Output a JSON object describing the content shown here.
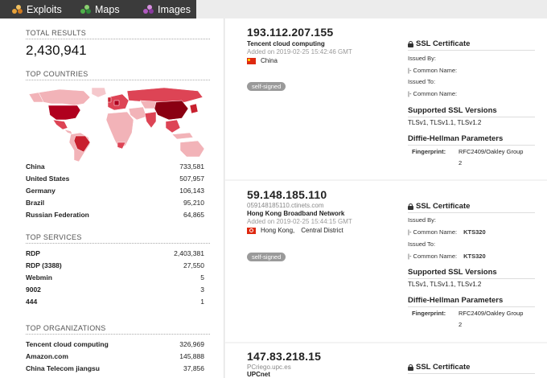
{
  "nav": {
    "items": [
      {
        "label": "Exploits",
        "icon": "exploits-icon"
      },
      {
        "label": "Maps",
        "icon": "maps-icon"
      },
      {
        "label": "Images",
        "icon": "images-icon"
      }
    ]
  },
  "sidebar": {
    "total_results_title": "TOTAL RESULTS",
    "total_results": "2,430,941",
    "top_countries_title": "TOP COUNTRIES",
    "countries": [
      {
        "name": "China",
        "count": "733,581"
      },
      {
        "name": "United States",
        "count": "507,957"
      },
      {
        "name": "Germany",
        "count": "106,143"
      },
      {
        "name": "Brazil",
        "count": "95,210"
      },
      {
        "name": "Russian Federation",
        "count": "64,865"
      }
    ],
    "top_services_title": "TOP SERVICES",
    "services": [
      {
        "name": "RDP",
        "count": "2,403,381"
      },
      {
        "name": "RDP (3388)",
        "count": "27,550"
      },
      {
        "name": "Webmin",
        "count": "5"
      },
      {
        "name": "9002",
        "count": "3"
      },
      {
        "name": "444",
        "count": "1"
      }
    ],
    "top_orgs_title": "TOP ORGANIZATIONS",
    "orgs": [
      {
        "name": "Tencent cloud computing",
        "count": "326,969"
      },
      {
        "name": "Amazon.com",
        "count": "145,888"
      },
      {
        "name": "China Telecom jiangsu",
        "count": "37,856"
      }
    ]
  },
  "results": [
    {
      "ip": "193.112.207.155",
      "org": "Tencent cloud computing",
      "added": "Added on 2019-02-25 15:42:46 GMT",
      "location": "China",
      "tag": "self-signed",
      "ssl_title": "SSL Certificate",
      "issued_by": "Issued By:",
      "common_name_1": "|- Common Name:",
      "issued_to": "Issued To:",
      "common_name_2": "|- Common Name:",
      "versions_title": "Supported SSL Versions",
      "versions": "TLSv1, TLSv1.1, TLSv1.2",
      "dh_title": "Diffie-Hellman Parameters",
      "fingerprint_label": "Fingerprint:",
      "fingerprint_value": "RFC2409/Oakley Group",
      "fingerprint_group": "2"
    },
    {
      "ip": "59.148.185.110",
      "hostname": "059148185110.ctinets.com",
      "org": "Hong Kong Broadband Network",
      "added": "Added on 2019-02-25 15:44:15 GMT",
      "location": "Hong Kong,",
      "city": "Central District",
      "tag": "self-signed",
      "ssl_title": "SSL Certificate",
      "issued_by": "Issued By:",
      "common_name_1": "|- Common Name:",
      "common_name_1_value": "KTS320",
      "issued_to": "Issued To:",
      "common_name_2": "|- Common Name:",
      "common_name_2_value": "KTS320",
      "versions_title": "Supported SSL Versions",
      "versions": "TLSv1, TLSv1.1, TLSv1.2",
      "dh_title": "Diffie-Hellman Parameters",
      "fingerprint_label": "Fingerprint:",
      "fingerprint_value": "RFC2409/Oakley Group",
      "fingerprint_group": "2"
    },
    {
      "ip": "147.83.218.15",
      "hostname": "PCriego.upc.es",
      "org": "UPCnet",
      "ssl_title": "SSL Certificate"
    }
  ],
  "colors": {
    "nav_dark": "#3b3b3b",
    "map_high": "#b0001e",
    "map_mid": "#dd4455",
    "map_low": "#f2b3b8",
    "tag_bg": "#9a9a9a"
  }
}
